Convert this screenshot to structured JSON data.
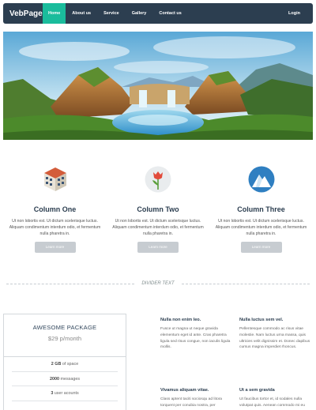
{
  "nav": {
    "brand": "VebPage",
    "links": [
      {
        "label": "Home",
        "active": true
      },
      {
        "label": "About us"
      },
      {
        "label": "Service"
      },
      {
        "label": "Gallery"
      },
      {
        "label": "Contact us"
      }
    ],
    "login": "Login"
  },
  "columns": [
    {
      "icon": "building-icon",
      "title": "Column One",
      "text": "Ut non lobortis est. Ut dictum scelerisque luctus. Aliquam condimentum interdum odio, et fermentum nulla pharetra in.",
      "button": "Learn more"
    },
    {
      "icon": "tulip-flower-icon",
      "title": "Column Two",
      "text": "Ut non lobortis est. Ut dictum scelerisque luctus. Aliquam condimentum interdum odio, et fermentum nulla pharetra in.",
      "button": "Learn more"
    },
    {
      "icon": "mountain-icon",
      "title": "Column Three",
      "text": "Ut non lobortis est. Ut dictum scelerisque luctus. Aliquam condimentum interdum odio, et fermentum nulla pharetra in.",
      "button": "Learn more"
    }
  ],
  "divider": {
    "text": "DIVIDER TEXT"
  },
  "package": {
    "title": "AWESOME PACKAGE",
    "price": "$29 p/month",
    "features": [
      {
        "strong": "2 GB",
        "rest": " of space"
      },
      {
        "strong": "2000",
        "rest": " messages"
      },
      {
        "strong": "3",
        "rest": " user acounts"
      }
    ]
  },
  "text_blocks": [
    {
      "title": "Nulla non enim leo.",
      "text": "Fusce ut magna ut neque gravida elementum eget id ante. Cras pharetra ligula sed risus congue, non iaculis ligula mollis."
    },
    {
      "title": "Nulla luctus sem vel.",
      "text": "Pellentesque commodo ac risus vitae molestie. Nam luctus urna massa, quis ultricies velit dignissim et. Donec dapibus cursus magna imperdiet rhoncus."
    },
    {
      "title": "Vivamus aliquam vitae.",
      "text": "Class aptent taciti sociosqu ad litora torquent per conubia nostra, per"
    },
    {
      "title": "Ut a sem gravida",
      "text": "Ut faucibus tortor et, id sodales nulla volutpat quis. Aenean commodo mi eu"
    }
  ],
  "colors": {
    "nav_bg": "#2c3e50",
    "accent": "#1abc9c",
    "button": "#c7ccd1"
  }
}
